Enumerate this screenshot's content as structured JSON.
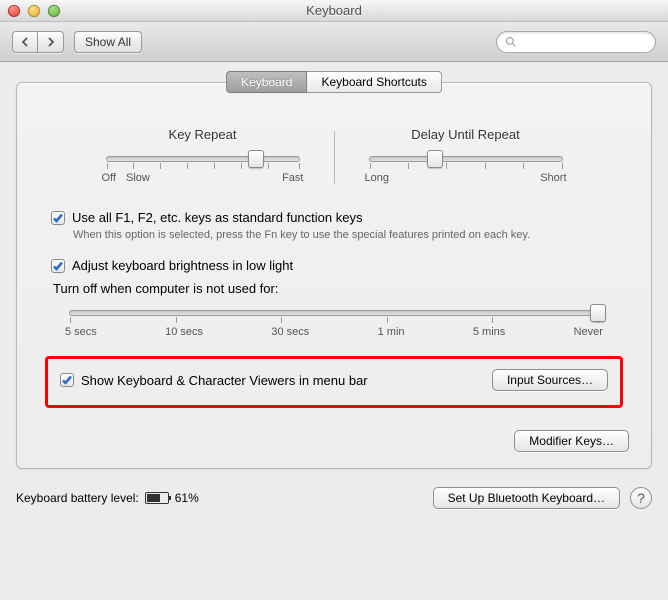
{
  "window": {
    "title": "Keyboard"
  },
  "toolbar": {
    "showall_label": "Show All",
    "search_placeholder": ""
  },
  "tabs": [
    {
      "label": "Keyboard",
      "active": true
    },
    {
      "label": "Keyboard Shortcuts",
      "active": false
    }
  ],
  "key_repeat": {
    "title": "Key Repeat",
    "left_label": "Off",
    "left2_label": "Slow",
    "right_label": "Fast",
    "value_pct": 78
  },
  "delay_repeat": {
    "title": "Delay Until Repeat",
    "left_label": "Long",
    "right_label": "Short",
    "value_pct": 34
  },
  "fn_keys": {
    "label": "Use all F1, F2, etc. keys as standard function keys",
    "hint": "When this option is selected, press the Fn key to use the special features printed on each key.",
    "checked": true
  },
  "brightness": {
    "label": "Adjust keyboard brightness in low light",
    "checked": true
  },
  "turnoff": {
    "label": "Turn off when computer is not used for:",
    "ticks": [
      "5 secs",
      "10 secs",
      "30 secs",
      "1 min",
      "5 mins",
      "Never"
    ],
    "value_pct": 100
  },
  "keyboard_viewer": {
    "label": "Show Keyboard & Character Viewers in menu bar",
    "checked": true,
    "button_label": "Input Sources…"
  },
  "modifier_button": "Modifier Keys…",
  "footer": {
    "battery_label": "Keyboard battery level:",
    "battery_pct": "61%",
    "battery_fill": 61,
    "bluetooth_button": "Set Up Bluetooth Keyboard…"
  }
}
